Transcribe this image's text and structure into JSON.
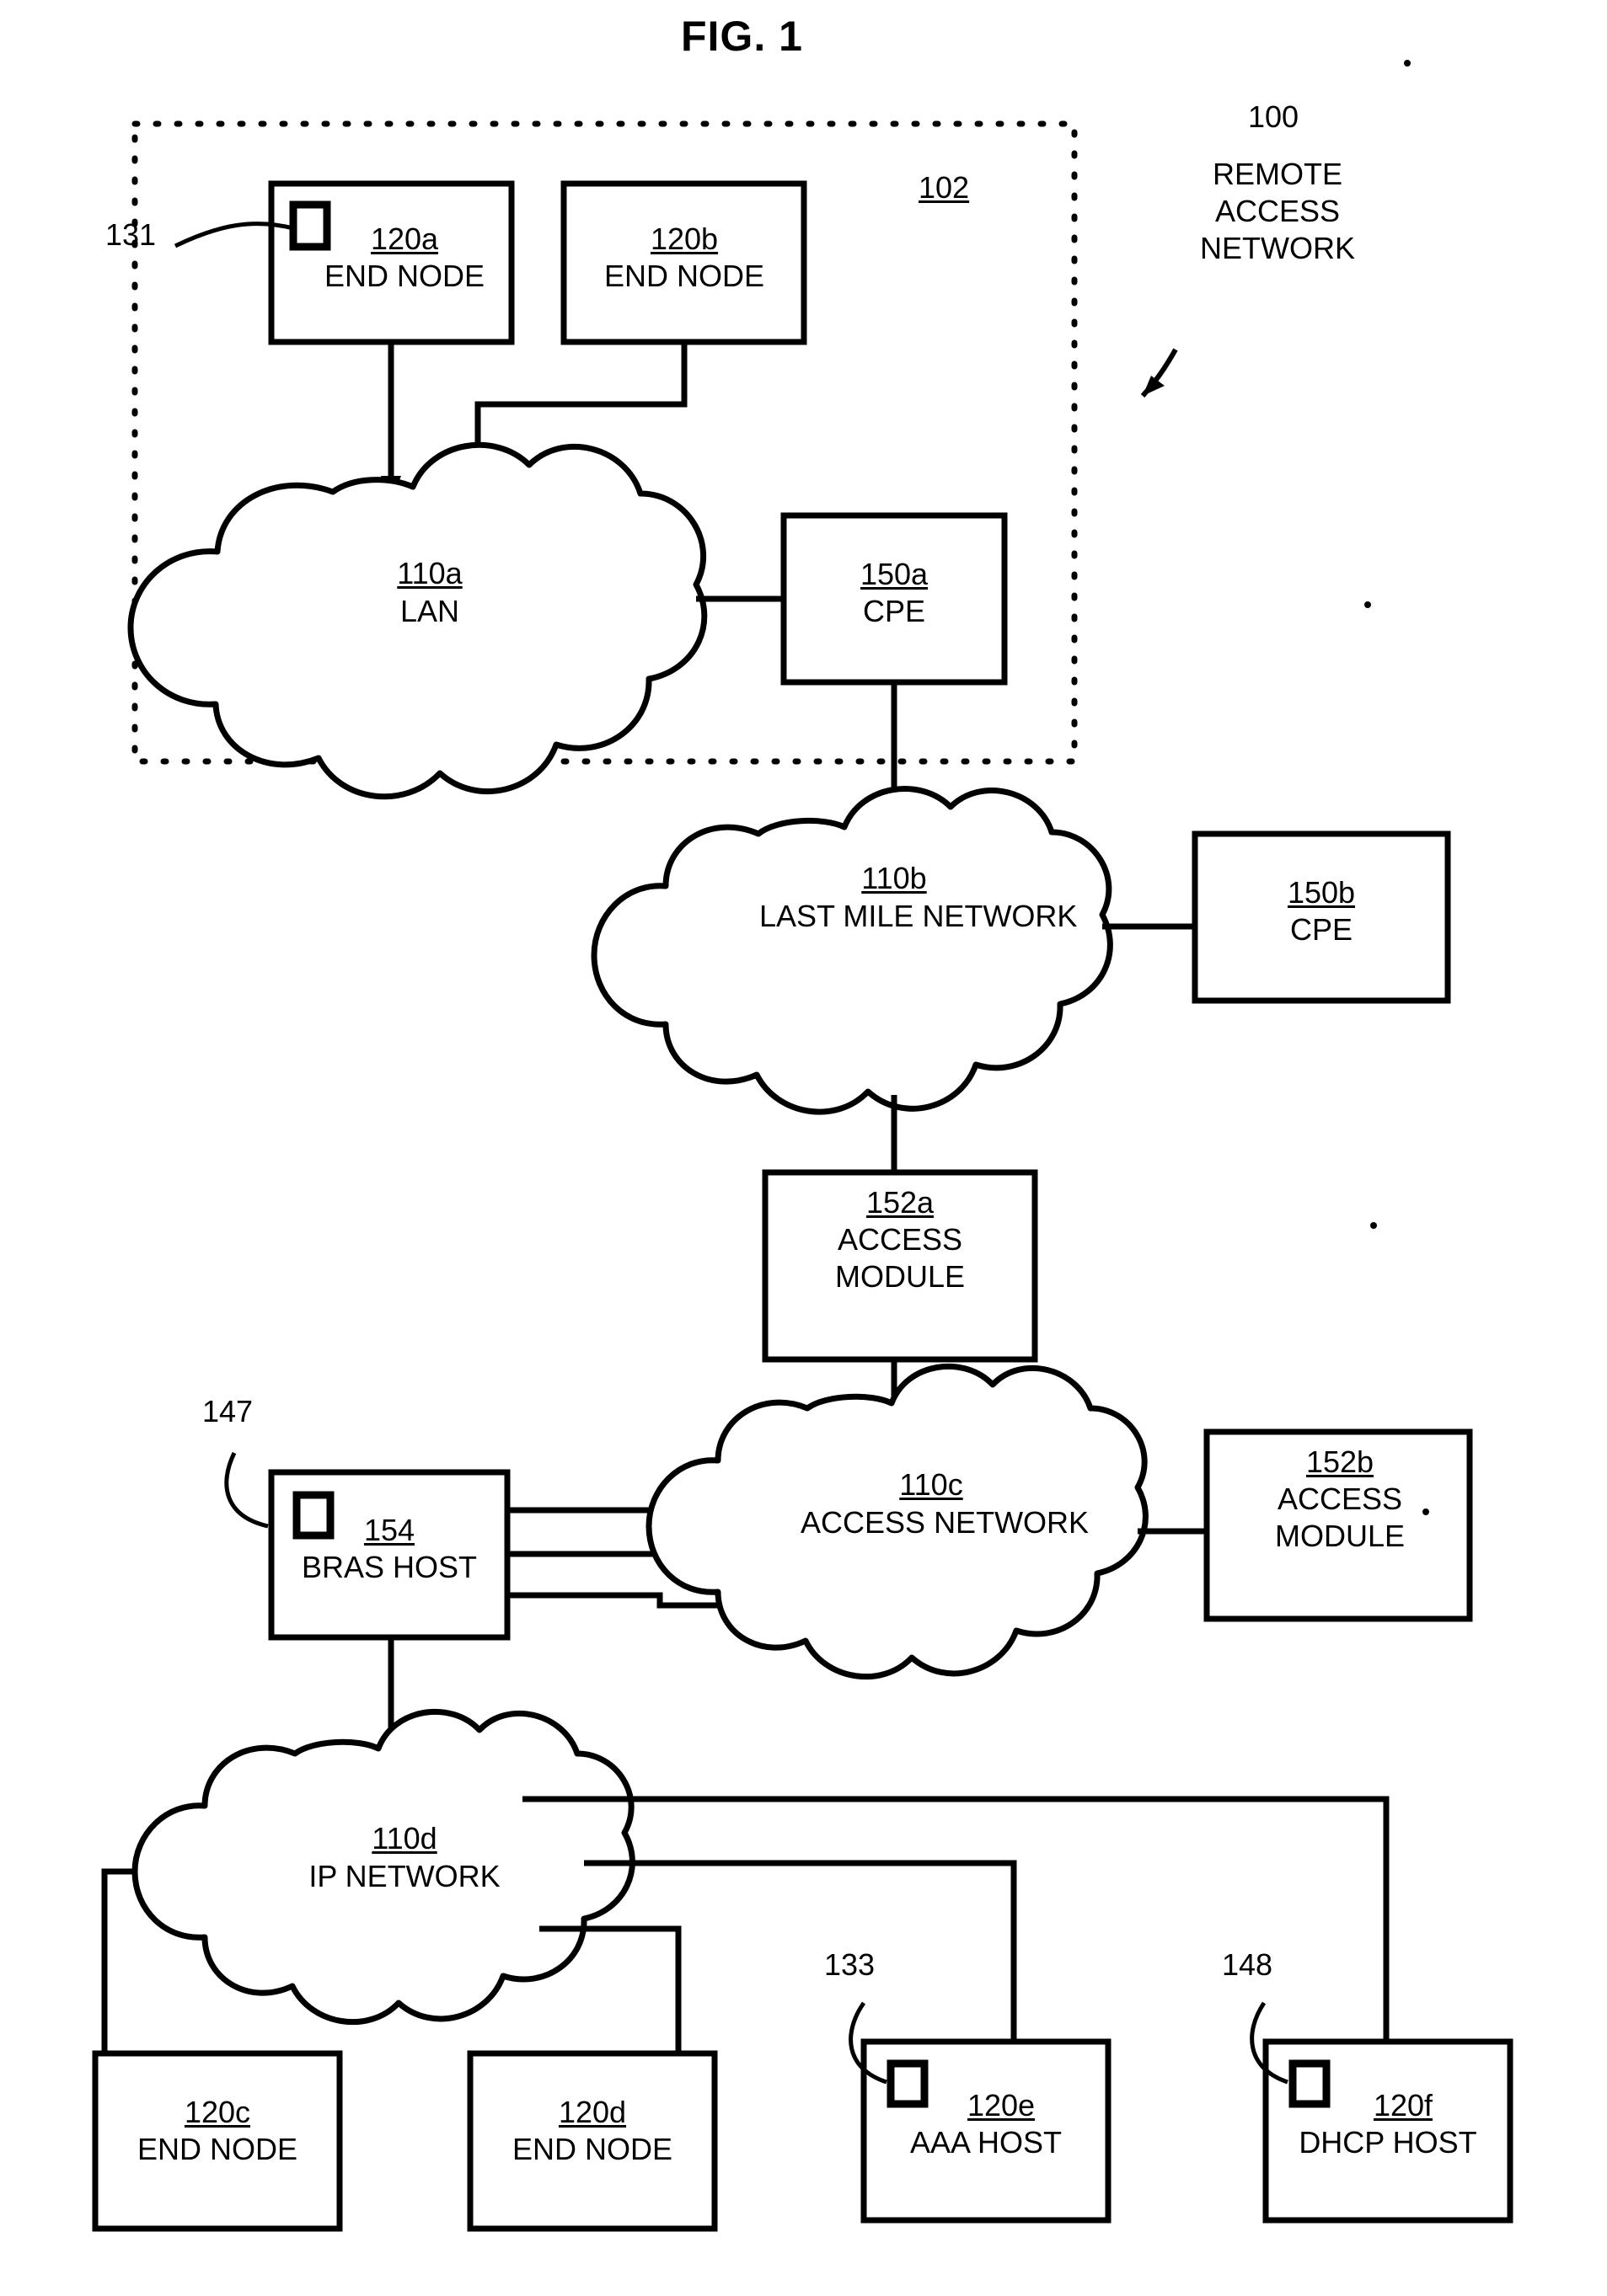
{
  "figure": {
    "title": "FIG. 1",
    "system_ref": "100",
    "system_label_lines": [
      "REMOTE",
      "ACCESS",
      "NETWORK"
    ],
    "remote_site_ref": "102"
  },
  "leaders": [
    {
      "name": "leader-131",
      "ref": "131"
    },
    {
      "name": "leader-147",
      "ref": "147"
    },
    {
      "name": "leader-133",
      "ref": "133"
    },
    {
      "name": "leader-148",
      "ref": "148"
    }
  ],
  "nodes": {
    "end_node_a": {
      "id": "120a",
      "name": "END NODE"
    },
    "end_node_b": {
      "id": "120b",
      "name": "END NODE"
    },
    "lan": {
      "id": "110a",
      "lines": [
        "LAN"
      ]
    },
    "cpe_a": {
      "id": "150a",
      "name": "CPE"
    },
    "last_mile": {
      "id": "110b",
      "lines": [
        "LAST MILE",
        "NETWORK"
      ]
    },
    "cpe_b": {
      "id": "150b",
      "name": "CPE"
    },
    "access_mod_a": {
      "id": "152a",
      "lines": [
        "ACCESS",
        "MODULE"
      ]
    },
    "bras_host": {
      "id": "154",
      "name": "BRAS HOST"
    },
    "access_net": {
      "id": "110c",
      "lines": [
        "ACCESS",
        "NETWORK"
      ]
    },
    "access_mod_b": {
      "id": "152b",
      "lines": [
        "ACCESS",
        "MODULE"
      ]
    },
    "ip_network": {
      "id": "110d",
      "lines": [
        "IP NETWORK"
      ]
    },
    "end_node_c": {
      "id": "120c",
      "name": "END NODE"
    },
    "end_node_d": {
      "id": "120d",
      "name": "END NODE"
    },
    "aaa_host": {
      "id": "120e",
      "name": "AAA HOST"
    },
    "dhcp_host": {
      "id": "120f",
      "name": "DHCP HOST"
    }
  },
  "colors": {
    "ink": "#000000",
    "paper": "#ffffff"
  }
}
